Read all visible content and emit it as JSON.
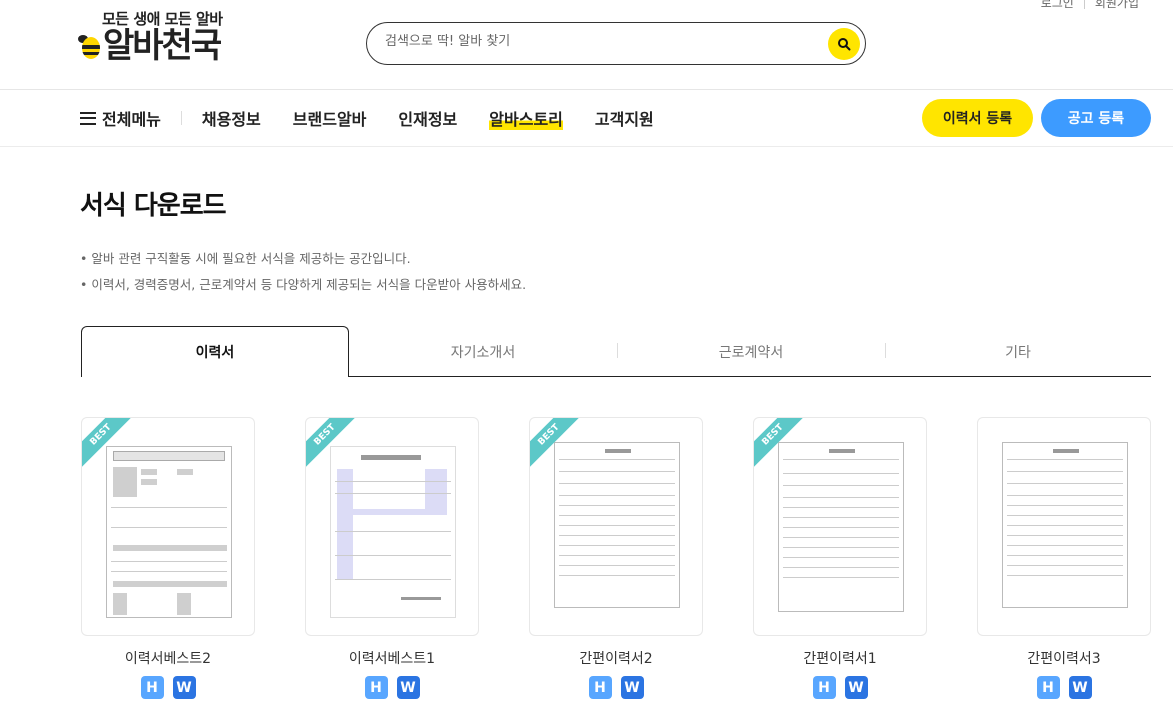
{
  "header": {
    "util_links": [
      "로그인",
      "회원가입"
    ],
    "tagline": "모든 생애 모든 알바",
    "brand": "알바천국",
    "search_placeholder": "검색으로 딱! 알바 찾기",
    "search_icon": "search-icon"
  },
  "nav": {
    "all_menu": "전체메뉴",
    "items": [
      "채용정보",
      "브랜드알바",
      "인재정보",
      "알바스토리",
      "고객지원"
    ],
    "resume_button": "이력서 등록",
    "post_button": "공고 등록"
  },
  "page": {
    "title": "서식 다운로드",
    "descriptions": [
      "• 알바 관련 구직활동 시에 필요한 서식을 제공하는 공간입니다.",
      "• 이력서, 경력증명서, 근로계약서 등 다양하게 제공되는 서식을 다운받아 사용하세요."
    ]
  },
  "tabs": [
    "이력서",
    "자기소개서",
    "근로계약서",
    "기타"
  ],
  "cards": [
    {
      "name": "이력서베스트2",
      "badge": "BEST",
      "formats": [
        "H",
        "W"
      ]
    },
    {
      "name": "이력서베스트1",
      "badge": "BEST",
      "formats": [
        "H",
        "W"
      ]
    },
    {
      "name": "간편이력서2",
      "badge": "BEST",
      "formats": [
        "H",
        "W"
      ]
    },
    {
      "name": "간편이력서1",
      "badge": "BEST",
      "formats": [
        "H",
        "W"
      ]
    },
    {
      "name": "간편이력서3",
      "badge": "",
      "formats": [
        "H",
        "W"
      ]
    }
  ],
  "colors": {
    "accent_yellow": "#ffe500",
    "accent_blue": "#3d9bff",
    "best_ribbon": "#5cc8c8",
    "hwp_blue": "#58a6ff",
    "word_blue": "#2b74e2"
  }
}
